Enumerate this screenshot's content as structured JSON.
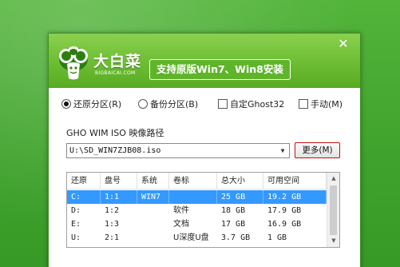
{
  "app": {
    "logo_name": "大白菜",
    "logo_domain": "BIGBAICAI.COM",
    "slogan": "支持原版Win7、Win8安装",
    "close_glyph": "✕"
  },
  "modes": [
    {
      "label": "还原分区(R)",
      "checked": true
    },
    {
      "label": "备份分区(B)",
      "checked": false
    }
  ],
  "options": [
    {
      "label": "自定Ghost32",
      "checked": false
    },
    {
      "label": "手动(M)",
      "checked": false
    }
  ],
  "image_path": {
    "label": "GHO WIM ISO 映像路径",
    "value": "U:\\SD_WIN7ZJB08.iso",
    "more_button": "更多(M)"
  },
  "table": {
    "columns": [
      "还原",
      "盘号",
      "系统",
      "卷标",
      "总大小",
      "可用空间"
    ],
    "rows": [
      {
        "cells": [
          "C:",
          "1:1",
          "WIN7",
          "",
          "25 GB",
          "19.2 GB"
        ],
        "selected": true
      },
      {
        "cells": [
          "D:",
          "1:2",
          "",
          "软件",
          "18 GB",
          "17.9 GB"
        ],
        "selected": false
      },
      {
        "cells": [
          "E:",
          "1:3",
          "",
          "文档",
          "17 GB",
          "16.9 GB"
        ],
        "selected": false
      },
      {
        "cells": [
          "U:",
          "2:1",
          "",
          "U深度U盘",
          "3.7 GB",
          "1 GB"
        ],
        "selected": false
      }
    ]
  },
  "colors": {
    "desktop": "#47a930",
    "header": "#6cbd33",
    "selection": "#3399ff",
    "more_border": "#c41010"
  }
}
